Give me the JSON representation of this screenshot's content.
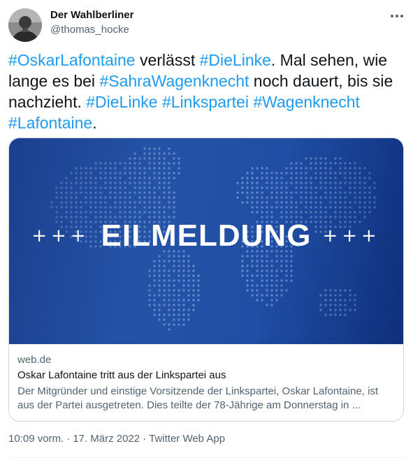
{
  "tweet": {
    "author_name": "Der Wahlberliner",
    "author_handle": "@thomas_hocke",
    "more_icon": "ellipsis-icon",
    "text_segments": [
      {
        "text": "#OskarLafontaine",
        "hashtag": true
      },
      {
        "text": " verlässt ",
        "hashtag": false
      },
      {
        "text": "#DieLinke",
        "hashtag": true
      },
      {
        "text": ". Mal sehen, wie lange es bei ",
        "hashtag": false
      },
      {
        "text": "#SahraWagenknecht",
        "hashtag": true
      },
      {
        "text": " noch dauert, bis sie nachzieht. ",
        "hashtag": false
      },
      {
        "text": "#DieLinke",
        "hashtag": true
      },
      {
        "text": " ",
        "hashtag": false
      },
      {
        "text": "#Linkspartei",
        "hashtag": true
      },
      {
        "text": " ",
        "hashtag": false
      },
      {
        "text": "#Wagenknecht",
        "hashtag": true
      },
      {
        "text": "\n",
        "hashtag": false
      },
      {
        "text": "#Lafontaine",
        "hashtag": true
      },
      {
        "text": ".",
        "hashtag": false
      }
    ],
    "time": "10:09 vorm.",
    "date": "17. März 2022",
    "source": "Twitter Web App"
  },
  "card": {
    "image_headline": "EILMELDUNG",
    "image_plus_left": "+++",
    "image_plus_right": "+++",
    "domain": "web.de",
    "title": "Oskar Lafontaine tritt aus der Linkspartei aus",
    "description": "Der Mitgründer und einstige Vorsitzende der Linkspartei, Oskar Lafontaine, ist aus der Partei ausgetreten. Dies teilte der 78-Jährige am Donnerstag in ..."
  },
  "colors": {
    "hashtag": "#1d9bf0",
    "text": "#0f1419",
    "secondary": "#536471",
    "card_bg_dark": "#0f2f7b",
    "card_bg_light": "#2453a6"
  }
}
